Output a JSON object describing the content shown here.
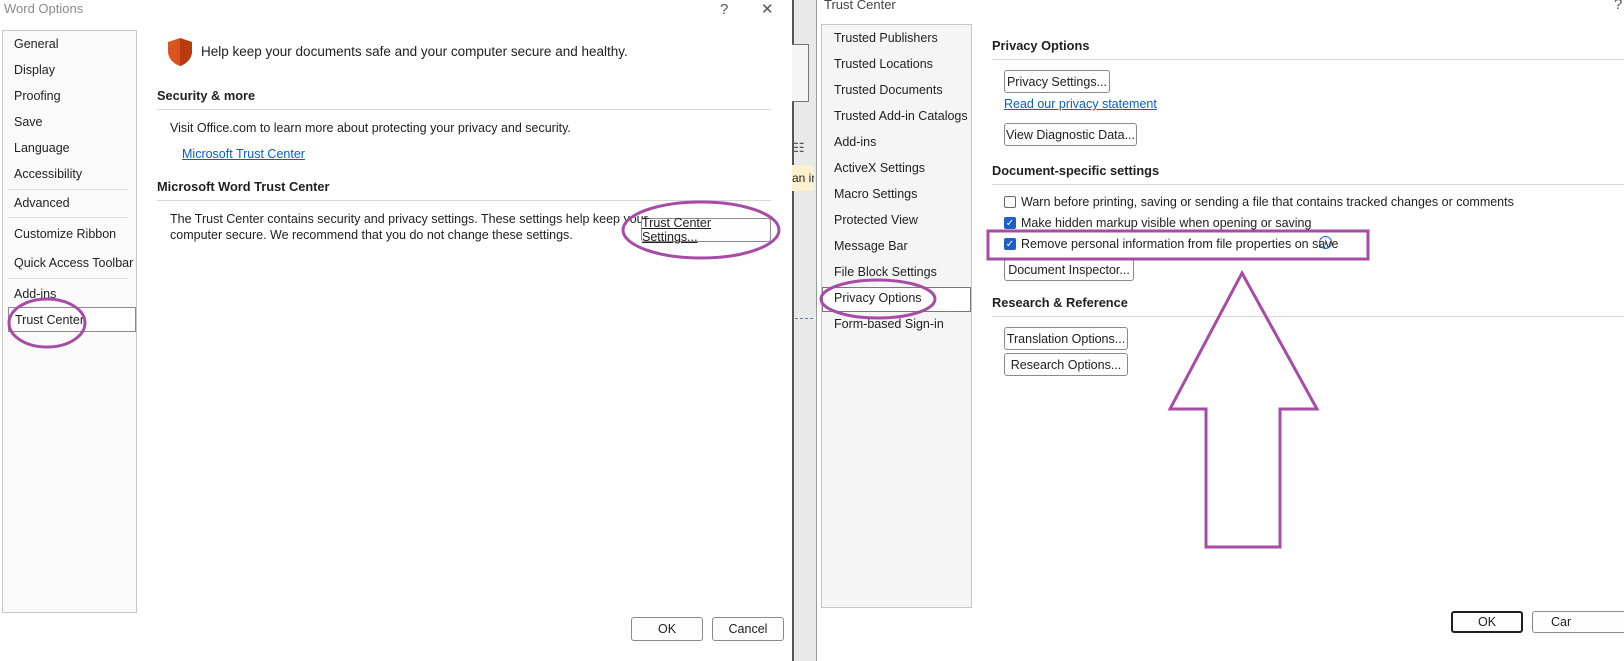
{
  "word_options": {
    "title": "Word Options",
    "help_glyph": "?",
    "close_glyph": "✕",
    "nav": [
      "General",
      "Display",
      "Proofing",
      "Save",
      "Language",
      "Accessibility",
      "Advanced",
      "Customize Ribbon",
      "Quick Access Toolbar",
      "Add-ins",
      "Trust Center"
    ],
    "selected": "Trust Center",
    "banner_text": "Help keep your documents safe and your computer secure and healthy.",
    "security_header": "Security & more",
    "security_text": "Visit Office.com to learn more about protecting your privacy and security.",
    "trust_link": "Microsoft Trust Center",
    "wtc_header": "Microsoft Word Trust Center",
    "wtc_text_1": "The Trust Center contains security and privacy settings. These settings help keep your",
    "wtc_text_2": "computer secure. We recommend that you do not change these settings.",
    "tc_settings_button": "Trust Center Settings...",
    "ok": "OK",
    "cancel": "Cancel"
  },
  "background_fragment": "an in",
  "trust_center": {
    "title": "Trust Center",
    "help_glyph": "?",
    "nav": [
      "Trusted Publishers",
      "Trusted Locations",
      "Trusted Documents",
      "Trusted Add-in Catalogs",
      "Add-ins",
      "ActiveX Settings",
      "Macro Settings",
      "Protected View",
      "Message Bar",
      "File Block Settings",
      "Privacy Options",
      "Form-based Sign-in"
    ],
    "selected": "Privacy Options",
    "privacy_header": "Privacy Options",
    "privacy_settings_button": "Privacy Settings...",
    "privacy_statement_link": "Read our privacy statement",
    "diagnostic_button": "View Diagnostic Data...",
    "doc_header": "Document-specific settings",
    "checks": [
      {
        "label": "Warn before printing, saving or sending a file that contains tracked changes or comments",
        "checked": false
      },
      {
        "label": "Make hidden markup visible when opening or saving",
        "checked": true
      },
      {
        "label": "Remove personal information from file properties on save",
        "checked": true
      }
    ],
    "info_glyph": "i",
    "doc_inspector_button": "Document Inspector...",
    "research_header": "Research & Reference",
    "translation_button": "Translation Options...",
    "research_button": "Research Options...",
    "ok": "OK",
    "cancel_partial": "Car"
  },
  "annotation_color": "#a64ca6",
  "accent_color": "#0a5fc2"
}
